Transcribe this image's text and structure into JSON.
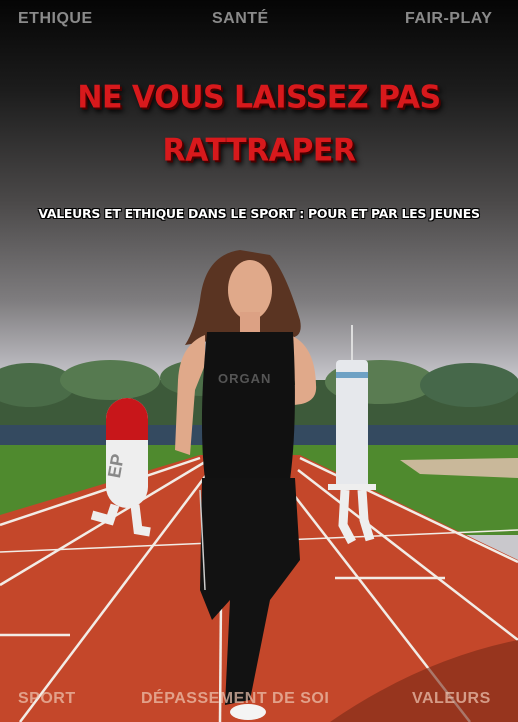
{
  "top_keywords": [
    "ETHIQUE",
    "SANTÉ",
    "FAIR-PLAY"
  ],
  "headline": {
    "line1": "NE VOUS LAISSEZ PAS",
    "line2": "RATTRAPER"
  },
  "subtitle": "VALEURS ET ETHIQUE DANS LE SPORT : POUR ET PAR LES JEUNES",
  "bottom_keywords": [
    "SPORT",
    "DÉPASSEMENT DE SOI",
    "VALEURS"
  ],
  "shirt_text": "ORGAN",
  "pill_text": "EP",
  "colors": {
    "headline": "#d8191c",
    "track": "#c4472a",
    "grass": "#4f8a2e"
  }
}
